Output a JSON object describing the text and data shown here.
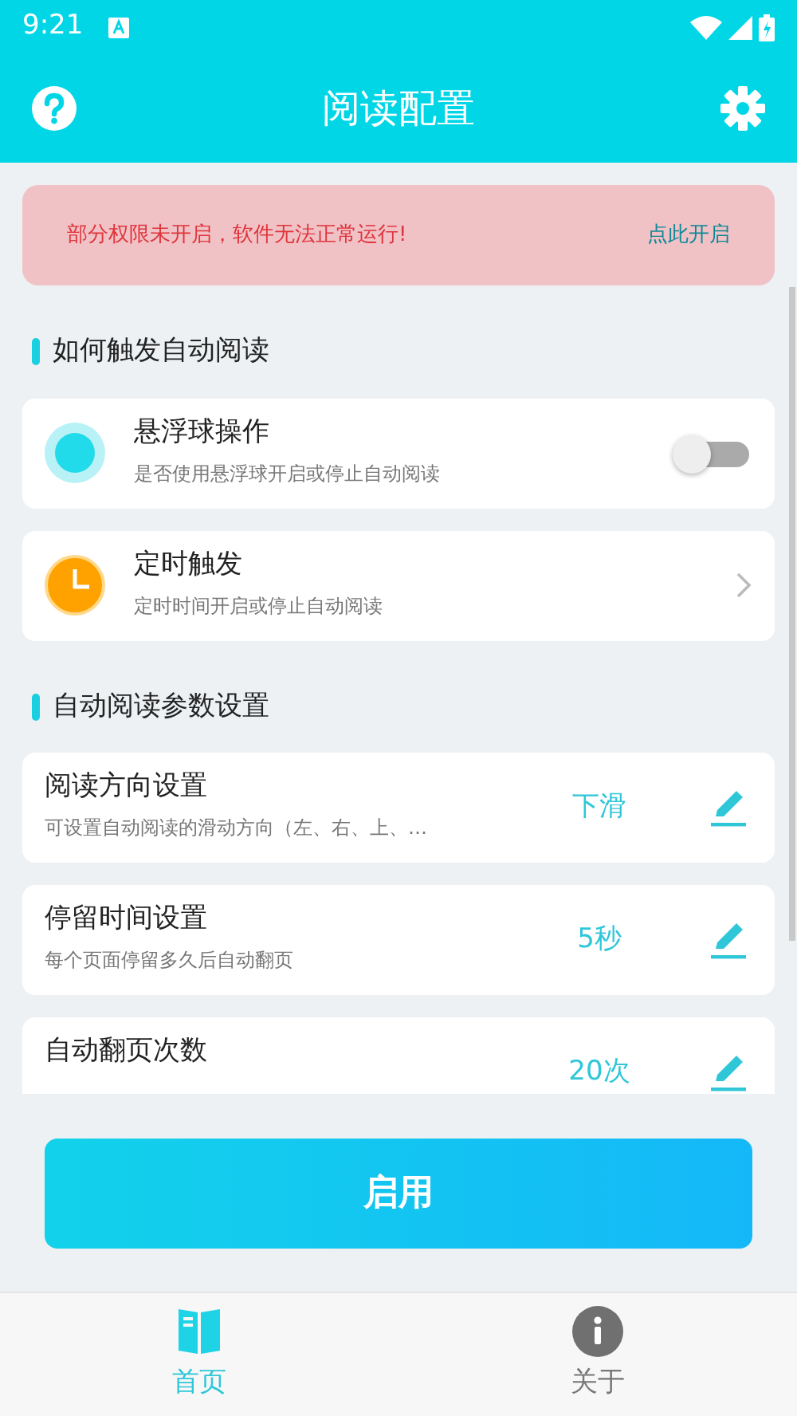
{
  "status_bar": {
    "time": "9:21"
  },
  "app_bar": {
    "title": "阅读配置"
  },
  "alert": {
    "message": "部分权限未开启，软件无法正常运行!",
    "action": "点此开启"
  },
  "sections": [
    {
      "title": "如何触发自动阅读",
      "items": [
        {
          "kind": "switch",
          "title": "悬浮球操作",
          "subtitle": "是否使用悬浮球开启或停止自动阅读",
          "on": false
        },
        {
          "kind": "link",
          "title": "定时触发",
          "subtitle": "定时时间开启或停止自动阅读"
        }
      ]
    },
    {
      "title": "自动阅读参数设置",
      "items": [
        {
          "kind": "edit",
          "title": "阅读方向设置",
          "subtitle": "可设置自动阅读的滑动方向（左、右、上、…",
          "value": "下滑"
        },
        {
          "kind": "edit",
          "title": "停留时间设置",
          "subtitle": "每个页面停留多久后自动翻页",
          "value": "5秒"
        },
        {
          "kind": "edit",
          "title": "自动翻页次数",
          "value": "20次"
        }
      ]
    }
  ],
  "primary_button": "启用",
  "bottom_nav": [
    {
      "label": "首页",
      "selected": true
    },
    {
      "label": "关于",
      "selected": false
    }
  ]
}
